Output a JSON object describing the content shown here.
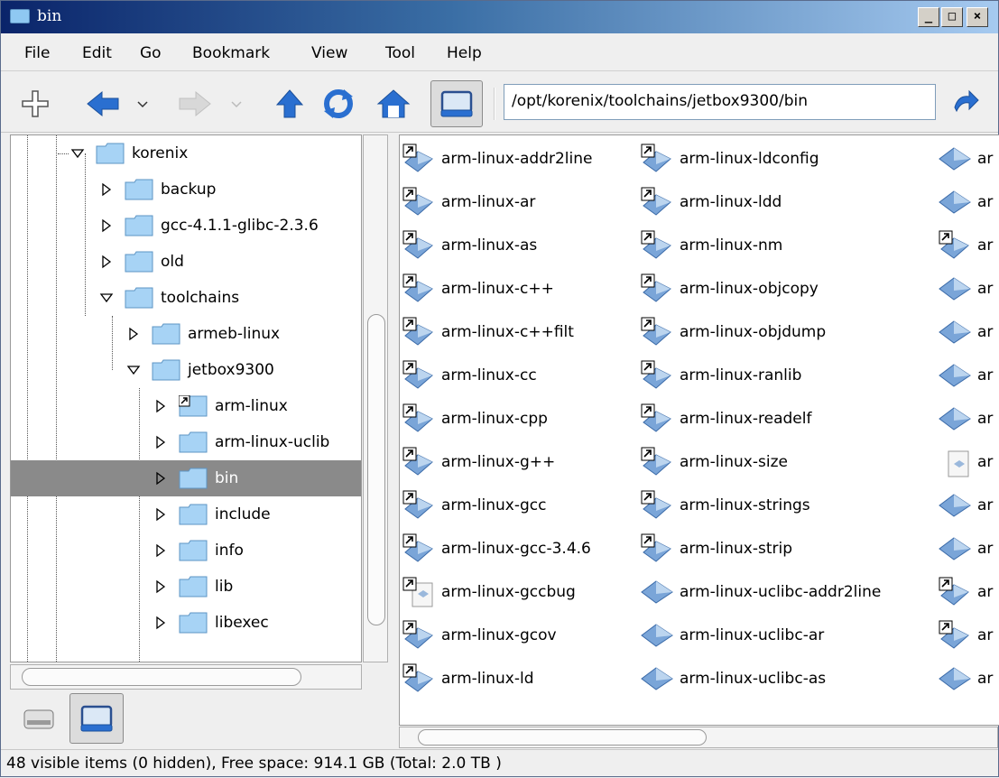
{
  "window": {
    "title": "bin"
  },
  "menu": [
    "File",
    "Edit",
    "Go",
    "Bookmark",
    "View",
    "Tool",
    "Help"
  ],
  "toolbar": {
    "location": "/opt/korenix/toolchains/jetbox9300/bin"
  },
  "tree": [
    {
      "label": "korenix",
      "expanded": true
    },
    {
      "label": "backup",
      "expanded": false
    },
    {
      "label": "gcc-4.1.1-glibc-2.3.6",
      "expanded": false
    },
    {
      "label": "old",
      "expanded": false
    },
    {
      "label": "toolchains",
      "expanded": true
    },
    {
      "label": "armeb-linux",
      "expanded": false
    },
    {
      "label": "jetbox9300",
      "expanded": true
    },
    {
      "label": "arm-linux",
      "expanded": false,
      "link": true
    },
    {
      "label": "arm-linux-uclib",
      "expanded": false
    },
    {
      "label": "bin",
      "expanded": false,
      "selected": true
    },
    {
      "label": "include",
      "expanded": false
    },
    {
      "label": "info",
      "expanded": false
    },
    {
      "label": "lib",
      "expanded": false
    },
    {
      "label": "libexec",
      "expanded": false
    }
  ],
  "files": {
    "col1": [
      "arm-linux-addr2line",
      "arm-linux-ar",
      "arm-linux-as",
      "arm-linux-c++",
      "arm-linux-c++filt",
      "arm-linux-cc",
      "arm-linux-cpp",
      "arm-linux-g++",
      "arm-linux-gcc",
      "arm-linux-gcc-3.4.6",
      "arm-linux-gccbug",
      "arm-linux-gcov",
      "arm-linux-ld"
    ],
    "col2": [
      "arm-linux-ldconfig",
      "arm-linux-ldd",
      "arm-linux-nm",
      "arm-linux-objcopy",
      "arm-linux-objdump",
      "arm-linux-ranlib",
      "arm-linux-readelf",
      "arm-linux-size",
      "arm-linux-strings",
      "arm-linux-strip",
      "arm-linux-uclibc-addr2line",
      "arm-linux-uclibc-ar",
      "arm-linux-uclibc-as"
    ],
    "col3": [
      "ar",
      "ar",
      "ar",
      "ar",
      "ar",
      "ar",
      "ar",
      "ar",
      "ar",
      "ar",
      "ar",
      "ar",
      "ar"
    ]
  },
  "status": {
    "text": "48 visible items (0 hidden), Free space: 914.1 GB (Total: 2.0 TB )"
  }
}
